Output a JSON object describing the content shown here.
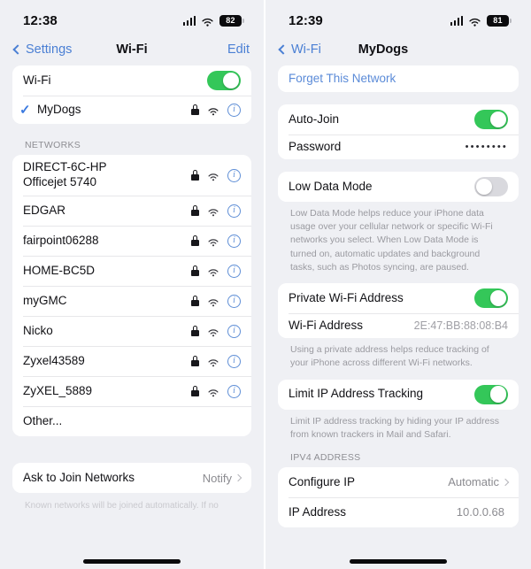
{
  "left_screen": {
    "status_bar": {
      "time": "12:38",
      "battery_level": "82",
      "cellular_icon": "cellular-bars-icon",
      "wifi_icon": "wifi-icon"
    },
    "nav": {
      "back_label": "Settings",
      "title": "Wi-Fi",
      "action_label": "Edit"
    },
    "wifi_toggle_row": {
      "label": "Wi-Fi",
      "state": "on"
    },
    "connected_network": {
      "name": "MyDogs",
      "checked": true,
      "lock_icon": "lock-icon",
      "signal_icon": "wifi-icon",
      "info_icon": "info-icon"
    },
    "networks_header": "NETWORKS",
    "networks": [
      {
        "name": "DIRECT-6C-HP",
        "name2": "Officejet 5740",
        "secured": true
      },
      {
        "name": "EDGAR",
        "name2": "",
        "secured": true
      },
      {
        "name": "fairpoint06288",
        "name2": "",
        "secured": true
      },
      {
        "name": "HOME-BC5D",
        "name2": "",
        "secured": true
      },
      {
        "name": "myGMC",
        "name2": "",
        "secured": true
      },
      {
        "name": "Nicko",
        "name2": "",
        "secured": true
      },
      {
        "name": "Zyxel43589",
        "name2": "",
        "secured": true
      },
      {
        "name": "ZyXEL_5889",
        "name2": "",
        "secured": true
      }
    ],
    "other_label": "Other...",
    "ask_to_join": {
      "label": "Ask to Join Networks",
      "value": "Notify"
    },
    "ask_footer": "Known networks will be joined automatically. If no"
  },
  "right_screen": {
    "status_bar": {
      "time": "12:39",
      "battery_level": "81",
      "cellular_icon": "cellular-bars-icon",
      "wifi_icon": "wifi-icon"
    },
    "nav": {
      "back_label": "Wi-Fi",
      "title": "MyDogs"
    },
    "forget_label": "Forget This Network",
    "auto_join": {
      "label": "Auto-Join",
      "state": "on"
    },
    "password": {
      "label": "Password",
      "masked_value": "••••••••"
    },
    "low_data_mode": {
      "label": "Low Data Mode",
      "state": "off"
    },
    "low_data_footer": "Low Data Mode helps reduce your iPhone data usage over your cellular network or specific Wi-Fi networks you select. When Low Data Mode is turned on, automatic updates and background tasks, such as Photos syncing, are paused.",
    "private_address": {
      "label": "Private Wi-Fi Address",
      "state": "on"
    },
    "wifi_address": {
      "label": "Wi-Fi Address",
      "value": "2E:47:BB:88:08:B4"
    },
    "private_footer": "Using a private address helps reduce tracking of your iPhone across different Wi-Fi networks.",
    "limit_ip": {
      "label": "Limit IP Address Tracking",
      "state": "on"
    },
    "limit_ip_footer": "Limit IP address tracking by hiding your IP address from known trackers in Mail and Safari.",
    "ipv4_header": "IPV4 ADDRESS",
    "configure_ip": {
      "label": "Configure IP",
      "value": "Automatic"
    },
    "ip_address": {
      "label": "IP Address",
      "value": "10.0.0.68"
    }
  },
  "colors": {
    "accent_blue": "#4a7fd4",
    "toggle_on_green": "#34c759",
    "toggle_off_gray": "#d9d9de",
    "background_gray": "#eff0f4",
    "card_white": "#ffffff"
  }
}
